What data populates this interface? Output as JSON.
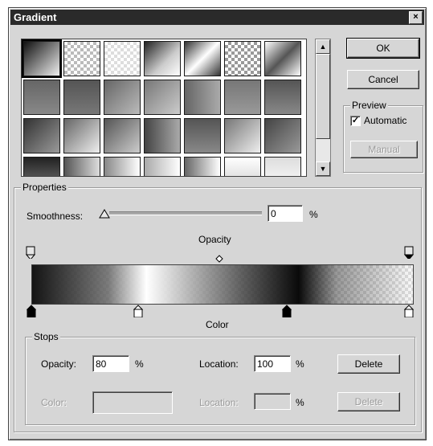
{
  "window": {
    "title": "Gradient",
    "close_label": "×"
  },
  "buttons": {
    "ok": "OK",
    "cancel": "Cancel",
    "manual": "Manual",
    "delete": "Delete",
    "delete_disabled": "Delete"
  },
  "preview": {
    "group_label": "Preview",
    "automatic_label": "Automatic",
    "automatic_checked": true,
    "check_glyph": "✓"
  },
  "properties": {
    "group_label": "Properties",
    "smoothness_label": "Smoothness:",
    "smoothness_value": "0",
    "smoothness_unit": "%",
    "opacity_heading": "Opacity",
    "color_heading": "Color"
  },
  "stops": {
    "group_label": "Stops",
    "opacity_label": "Opacity:",
    "opacity_value": "80",
    "opacity_unit": "%",
    "opacity_location_label": "Location:",
    "opacity_location_value": "100",
    "opacity_location_unit": "%",
    "color_label": "Color:",
    "color_location_label": "Location:",
    "color_location_unit": "%"
  },
  "icons": {
    "scroll_up": "▲",
    "scroll_down": "▼",
    "smoothness_thumb": "triangle-icon",
    "opacity_stop": "opacity-stop-icon",
    "color_stop": "color-stop-icon",
    "midpoint": "diamond-icon"
  },
  "colors": {
    "titlebar": "#2a2a2a",
    "dialog_bg": "#d6d6d6"
  }
}
